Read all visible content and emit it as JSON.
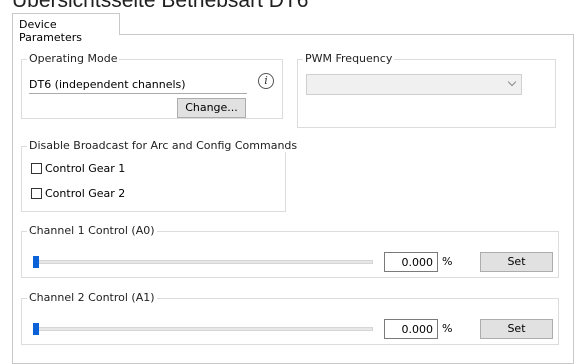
{
  "page": {
    "title": "Übersichtsseite Betriebsart DT6"
  },
  "tabs": [
    {
      "label": "Device Parameters",
      "active": true
    }
  ],
  "operating_mode": {
    "group_title": "Operating Mode",
    "value": "DT6 (independent channels)",
    "info_icon": "info-icon",
    "change_label": "Change..."
  },
  "pwm_frequency": {
    "group_title": "PWM Frequency",
    "selected": "",
    "disabled": true
  },
  "disable_broadcast": {
    "group_title": "Disable Broadcast for Arc and Config Commands",
    "options": [
      {
        "label": "Control Gear 1",
        "checked": false
      },
      {
        "label": "Control Gear 2",
        "checked": false
      }
    ]
  },
  "channels": [
    {
      "group_title": "Channel 1 Control (A0)",
      "value": "0.000",
      "unit": "%",
      "set_label": "Set",
      "level_percent": 0
    },
    {
      "group_title": "Channel 2 Control (A1)",
      "value": "0.000",
      "unit": "%",
      "set_label": "Set",
      "level_percent": 0
    }
  ],
  "colors": {
    "slider_thumb": "#0a62d6",
    "border": "#dcdcdc"
  }
}
